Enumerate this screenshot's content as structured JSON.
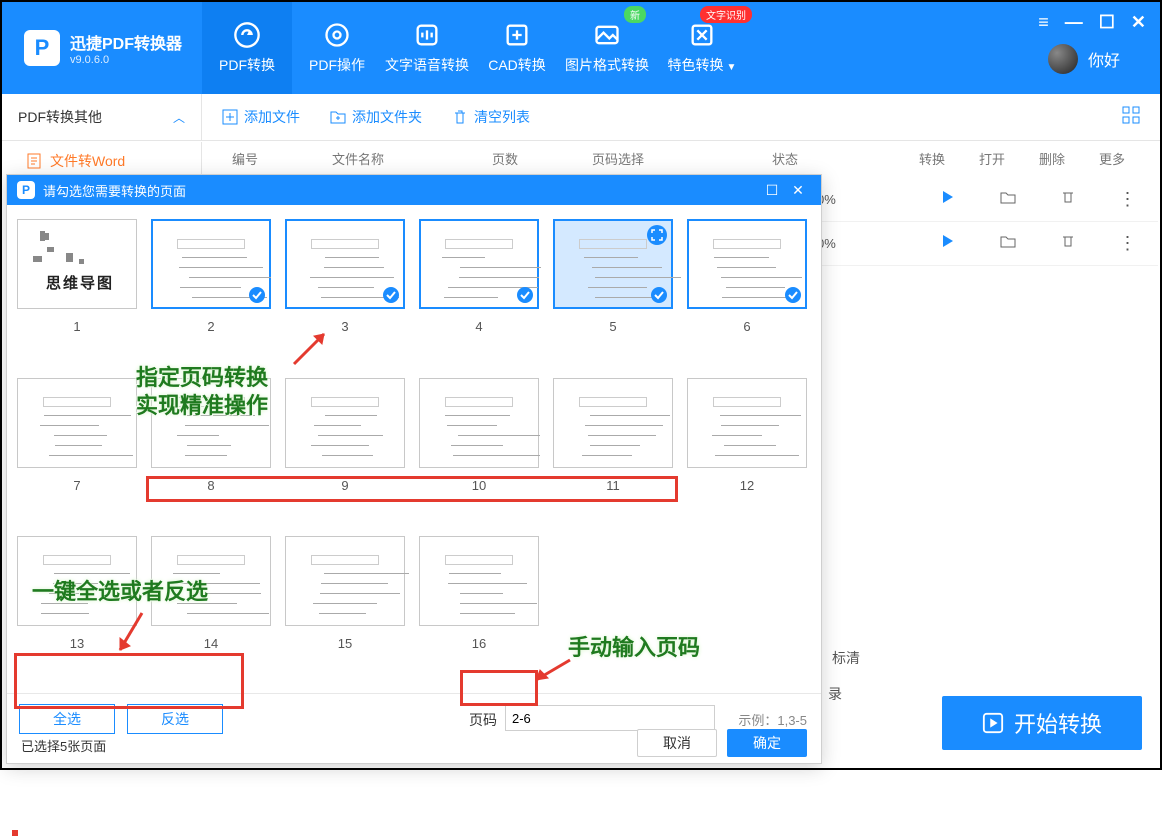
{
  "app": {
    "name": "迅捷PDF转换器",
    "version": "v9.0.6.0"
  },
  "topTabs": [
    {
      "label": "PDF转换",
      "active": true
    },
    {
      "label": "PDF操作"
    },
    {
      "label": "文字语音转换"
    },
    {
      "label": "CAD转换"
    },
    {
      "label": "图片格式转换",
      "badge_new": "新"
    },
    {
      "label": "特色转换",
      "badge_ocr": "文字识别"
    }
  ],
  "user": {
    "greeting": "你好"
  },
  "sidebar": {
    "header": "PDF转换其他",
    "item": "文件转Word"
  },
  "toolbar": {
    "add_file": "添加文件",
    "add_folder": "添加文件夹",
    "clear": "清空列表"
  },
  "table": {
    "headers": {
      "index": "编号",
      "name": "文件名称",
      "pages": "页数",
      "range": "页码选择",
      "status": "状态",
      "convert": "转换",
      "open": "打开",
      "delete": "删除",
      "more": "更多"
    },
    "rows": [
      {
        "progress": "0%"
      },
      {
        "progress": "0%"
      }
    ]
  },
  "mainBottom": {
    "tag": "标清",
    "path_marker": "录",
    "start": "开始转换"
  },
  "modal": {
    "title": "请勾选您需要转换的页面",
    "pages_total": 16,
    "mindmap_label": "思维导图",
    "selected_pages": [
      2,
      3,
      4,
      5,
      6
    ],
    "hover_page": 5,
    "select_all": "全选",
    "invert": "反选",
    "page_label": "页码",
    "page_value": "2-6",
    "example": "示例：1,3-5",
    "status": "已选择5张页面",
    "cancel": "取消",
    "ok": "确定"
  },
  "annotations": {
    "callout1_line1": "指定页码转换",
    "callout1_line2": "实现精准操作",
    "callout2": "一键全选或者反选",
    "callout3": "手动输入页码"
  }
}
